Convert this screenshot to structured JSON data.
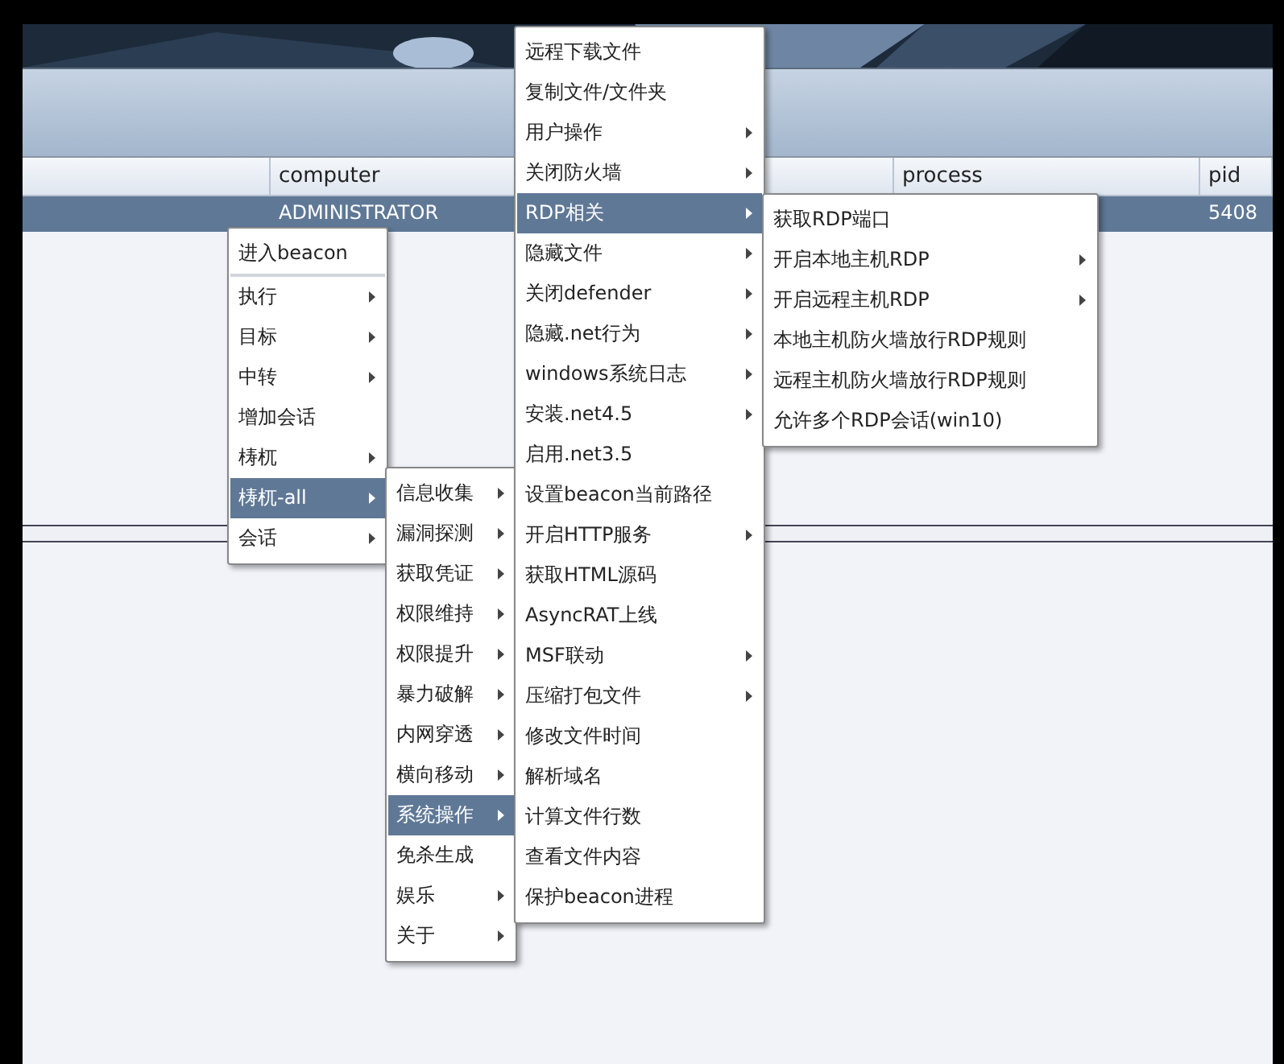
{
  "table": {
    "columns": [
      {
        "label": "computer"
      },
      {
        "label": "process"
      },
      {
        "label": "pid"
      }
    ],
    "rows": [
      {
        "computer": "ADMINISTRATOR",
        "pid": "5408",
        "selected": true
      }
    ]
  },
  "menus": [
    {
      "items": [
        {
          "label": "进入beacon",
          "submenu": false,
          "selected": false,
          "separator_after": true
        },
        {
          "label": "执行",
          "submenu": true,
          "selected": false,
          "separator_after": false
        },
        {
          "label": "目标",
          "submenu": true,
          "selected": false,
          "separator_after": false
        },
        {
          "label": "中转",
          "submenu": true,
          "selected": false,
          "separator_after": false
        },
        {
          "label": "增加会话",
          "submenu": false,
          "selected": false,
          "separator_after": false
        },
        {
          "label": "梼杌",
          "submenu": true,
          "selected": false,
          "separator_after": false
        },
        {
          "label": "梼杌-all",
          "submenu": true,
          "selected": true,
          "separator_after": false
        },
        {
          "label": "会话",
          "submenu": true,
          "selected": false,
          "separator_after": false
        }
      ]
    },
    {
      "items": [
        {
          "label": "信息收集",
          "submenu": true,
          "selected": false,
          "separator_after": false
        },
        {
          "label": "漏洞探测",
          "submenu": true,
          "selected": false,
          "separator_after": false
        },
        {
          "label": "获取凭证",
          "submenu": true,
          "selected": false,
          "separator_after": false
        },
        {
          "label": "权限维持",
          "submenu": true,
          "selected": false,
          "separator_after": false
        },
        {
          "label": "权限提升",
          "submenu": true,
          "selected": false,
          "separator_after": false
        },
        {
          "label": "暴力破解",
          "submenu": true,
          "selected": false,
          "separator_after": false
        },
        {
          "label": "内网穿透",
          "submenu": true,
          "selected": false,
          "separator_after": false
        },
        {
          "label": "横向移动",
          "submenu": true,
          "selected": false,
          "separator_after": false
        },
        {
          "label": "系统操作",
          "submenu": true,
          "selected": true,
          "separator_after": false
        },
        {
          "label": "免杀生成",
          "submenu": false,
          "selected": false,
          "separator_after": false
        },
        {
          "label": "娱乐",
          "submenu": true,
          "selected": false,
          "separator_after": false
        },
        {
          "label": "关于",
          "submenu": true,
          "selected": false,
          "separator_after": false
        }
      ]
    },
    {
      "items": [
        {
          "label": "远程下载文件",
          "submenu": false,
          "selected": false,
          "separator_after": false
        },
        {
          "label": "复制文件/文件夹",
          "submenu": false,
          "selected": false,
          "separator_after": false
        },
        {
          "label": "用户操作",
          "submenu": true,
          "selected": false,
          "separator_after": false
        },
        {
          "label": "关闭防火墙",
          "submenu": true,
          "selected": false,
          "separator_after": false
        },
        {
          "label": "RDP相关",
          "submenu": true,
          "selected": true,
          "separator_after": false
        },
        {
          "label": "隐藏文件",
          "submenu": true,
          "selected": false,
          "separator_after": false
        },
        {
          "label": "关闭defender",
          "submenu": true,
          "selected": false,
          "separator_after": false
        },
        {
          "label": "隐藏.net行为",
          "submenu": true,
          "selected": false,
          "separator_after": false
        },
        {
          "label": "windows系统日志",
          "submenu": true,
          "selected": false,
          "separator_after": false
        },
        {
          "label": "安装.net4.5",
          "submenu": true,
          "selected": false,
          "separator_after": false
        },
        {
          "label": "启用.net3.5",
          "submenu": false,
          "selected": false,
          "separator_after": false
        },
        {
          "label": "设置beacon当前路径",
          "submenu": false,
          "selected": false,
          "separator_after": false
        },
        {
          "label": "开启HTTP服务",
          "submenu": true,
          "selected": false,
          "separator_after": false
        },
        {
          "label": "获取HTML源码",
          "submenu": false,
          "selected": false,
          "separator_after": false
        },
        {
          "label": "AsyncRAT上线",
          "submenu": false,
          "selected": false,
          "separator_after": false
        },
        {
          "label": "MSF联动",
          "submenu": true,
          "selected": false,
          "separator_after": false
        },
        {
          "label": "压缩打包文件",
          "submenu": true,
          "selected": false,
          "separator_after": false
        },
        {
          "label": "修改文件时间",
          "submenu": false,
          "selected": false,
          "separator_after": false
        },
        {
          "label": "解析域名",
          "submenu": false,
          "selected": false,
          "separator_after": false
        },
        {
          "label": "计算文件行数",
          "submenu": false,
          "selected": false,
          "separator_after": false
        },
        {
          "label": "查看文件内容",
          "submenu": false,
          "selected": false,
          "separator_after": false
        },
        {
          "label": "保护beacon进程",
          "submenu": false,
          "selected": false,
          "separator_after": false
        }
      ]
    },
    {
      "items": [
        {
          "label": "获取RDP端口",
          "submenu": false,
          "selected": false,
          "separator_after": false
        },
        {
          "label": "开启本地主机RDP",
          "submenu": true,
          "selected": false,
          "separator_after": false
        },
        {
          "label": "开启远程主机RDP",
          "submenu": true,
          "selected": false,
          "separator_after": false
        },
        {
          "label": "本地主机防火墙放行RDP规则",
          "submenu": false,
          "selected": false,
          "separator_after": false
        },
        {
          "label": "远程主机防火墙放行RDP规则",
          "submenu": false,
          "selected": false,
          "separator_after": false
        },
        {
          "label": "允许多个RDP会话(win10)",
          "submenu": false,
          "selected": false,
          "separator_after": false
        }
      ]
    }
  ]
}
